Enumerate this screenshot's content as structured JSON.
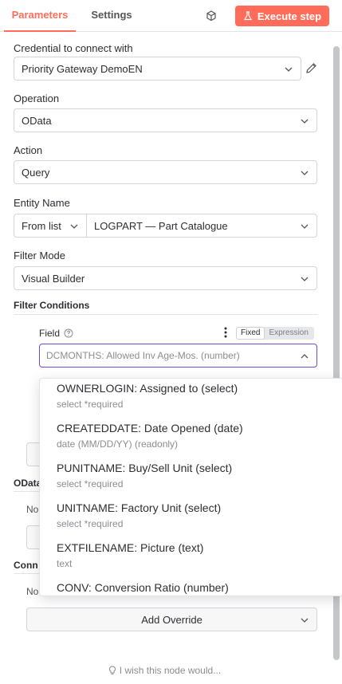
{
  "header": {
    "tabs": [
      {
        "label": "Parameters",
        "active": true
      },
      {
        "label": "Settings",
        "active": false
      }
    ],
    "execute_label": "Execute step",
    "accent": "#ff6d5a"
  },
  "form": {
    "credential": {
      "label": "Credential to connect with",
      "value": "Priority Gateway DemoEN"
    },
    "operation": {
      "label": "Operation",
      "value": "OData"
    },
    "action": {
      "label": "Action",
      "value": "Query"
    },
    "entity": {
      "label": "Entity Name",
      "mode": "From list",
      "value": "LOGPART — Part Catalogue"
    },
    "filter_mode": {
      "label": "Filter Mode",
      "value": "Visual Builder"
    },
    "filter_conditions": {
      "label": "Filter Conditions"
    },
    "field": {
      "label": "Field",
      "toggle_fixed": "Fixed",
      "toggle_expression": "Expression",
      "value": "DCMONTHS: Allowed Inv Age-Mos. (number)"
    },
    "odata_label": "OData",
    "odata_no": "No",
    "conn_label": "Conn",
    "conn_no": "No",
    "add_override": "Add Override",
    "wish": "I wish this node would..."
  },
  "dropdown": {
    "options": [
      {
        "title": "OWNERLOGIN: Assigned to (select)",
        "sub": "select *required"
      },
      {
        "title": "CREATEDDATE: Date Opened (date)",
        "sub": "date (MM/DD/YY) (readonly)"
      },
      {
        "title": "PUNITNAME: Buy/Sell Unit (select)",
        "sub": "select *required"
      },
      {
        "title": "UNITNAME: Factory Unit (select)",
        "sub": "select *required"
      },
      {
        "title": "EXTFILENAME: Picture (text)",
        "sub": "text"
      },
      {
        "title": "CONV: Conversion Ratio (number)",
        "sub": ""
      }
    ]
  }
}
